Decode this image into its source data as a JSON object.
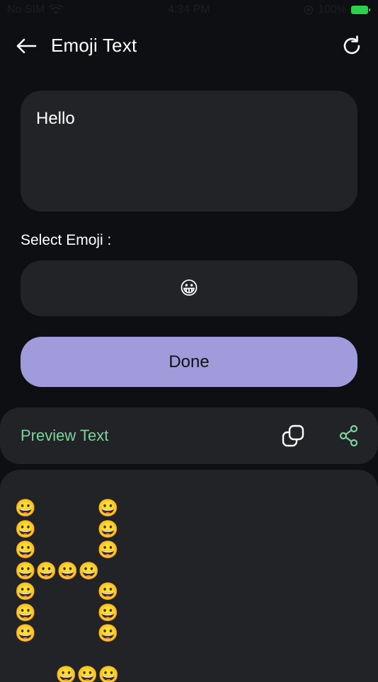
{
  "status_bar": {
    "carrier": "No SIM",
    "time": "4:34 PM",
    "battery": "100%"
  },
  "header": {
    "title": "Emoji Text",
    "back_icon": "arrow-left-icon",
    "refresh_icon": "refresh-icon"
  },
  "input": {
    "value": "Hello"
  },
  "emoji_picker": {
    "label": "Select Emoji :",
    "selected": "😀"
  },
  "done_button": {
    "label": "Done"
  },
  "preview": {
    "title": "Preview Text",
    "copy_icon": "copy-icon",
    "share_icon": "share-icon",
    "art": "😀      😀\n😀      😀\n😀      😀\n😀😀😀😀\n😀      😀\n😀      😀\n😀      😀\n\n    😀😀😀"
  },
  "colors": {
    "background": "#0d0f12",
    "card": "#222327",
    "accent_button": "#a19bdc",
    "preview_title": "#7dd39b",
    "battery": "#2bd14a"
  }
}
